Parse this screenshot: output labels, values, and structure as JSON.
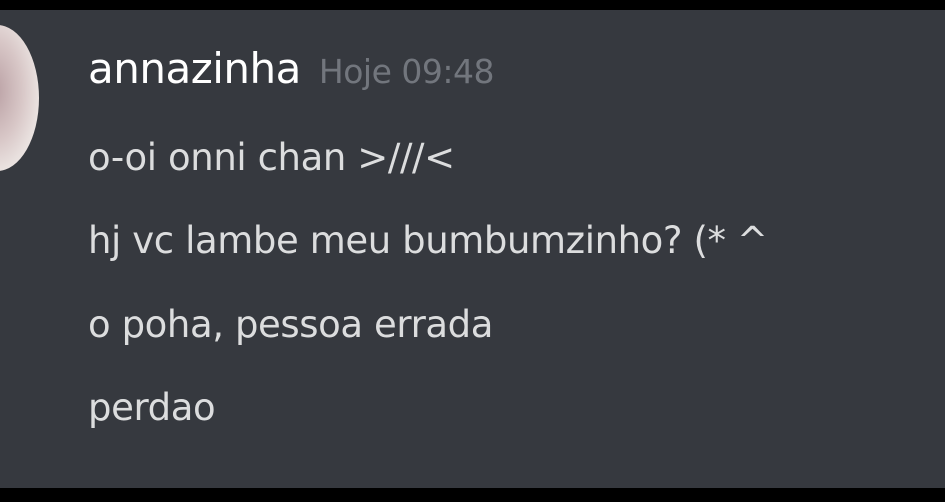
{
  "message": {
    "author": "annazinha",
    "timestamp": "Hoje 09:48",
    "lines": [
      "o-oi onni chan >///<",
      "hj vc lambe meu bumbumzinho? (* ^",
      "o poha, pessoa errada",
      "perdao"
    ]
  },
  "colors": {
    "background": "#36393f",
    "username": "#ffffff",
    "timestamp": "#72767d",
    "text": "#dcddde"
  }
}
